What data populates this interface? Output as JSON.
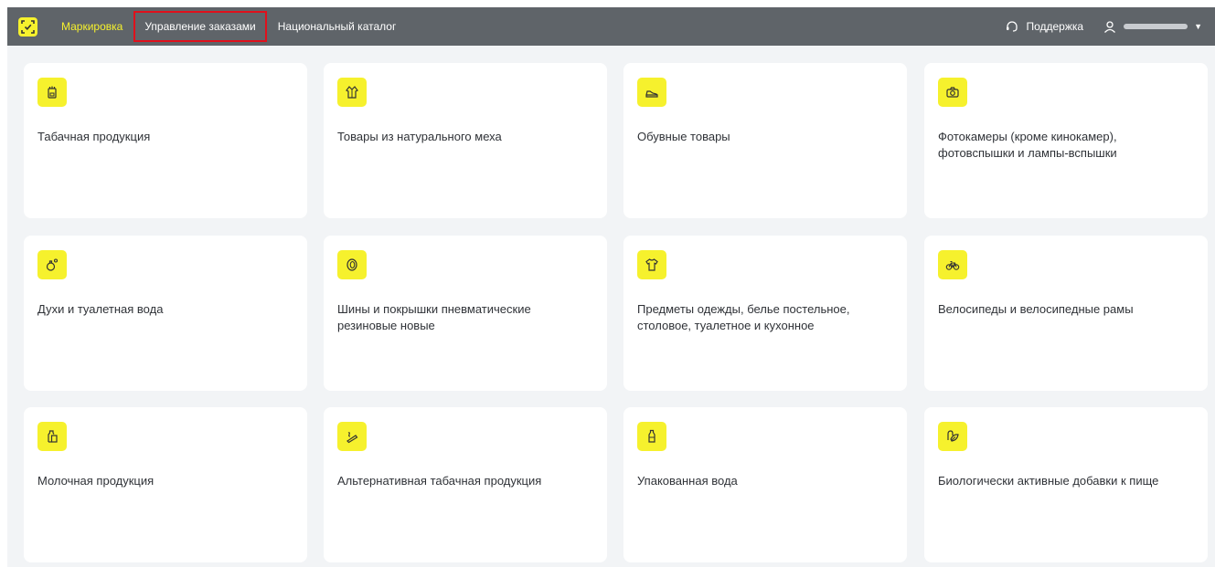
{
  "header": {
    "nav": [
      {
        "label": "Маркировка"
      },
      {
        "label": "Управление заказами"
      },
      {
        "label": "Национальный каталог"
      }
    ],
    "support_label": "Поддержка"
  },
  "accent_color": "#f6f12d",
  "highlight_color": "#e0101c",
  "categories": [
    {
      "label": "Табачная продукция",
      "icon": "cigarette-pack-icon"
    },
    {
      "label": "Товары из натурального меха",
      "icon": "fur-coat-icon"
    },
    {
      "label": "Обувные товары",
      "icon": "shoe-icon"
    },
    {
      "label": "Фотокамеры (кроме кинокамер), фотовспышки и лампы-вспышки",
      "icon": "camera-icon"
    },
    {
      "label": "Духи и туалетная вода",
      "icon": "perfume-icon"
    },
    {
      "label": "Шины и покрышки пневматические резиновые новые",
      "icon": "tire-icon"
    },
    {
      "label": "Предметы одежды, белье постельное, столовое, туалетное и кухонное",
      "icon": "tshirt-icon"
    },
    {
      "label": "Велосипеды и велосипедные рамы",
      "icon": "bicycle-icon"
    },
    {
      "label": "Молочная продукция",
      "icon": "milk-icon"
    },
    {
      "label": "Альтернативная табачная продукция",
      "icon": "vape-icon"
    },
    {
      "label": "Упакованная вода",
      "icon": "water-bottle-icon"
    },
    {
      "label": "Биологически активные добавки к пище",
      "icon": "supplement-icon"
    }
  ]
}
